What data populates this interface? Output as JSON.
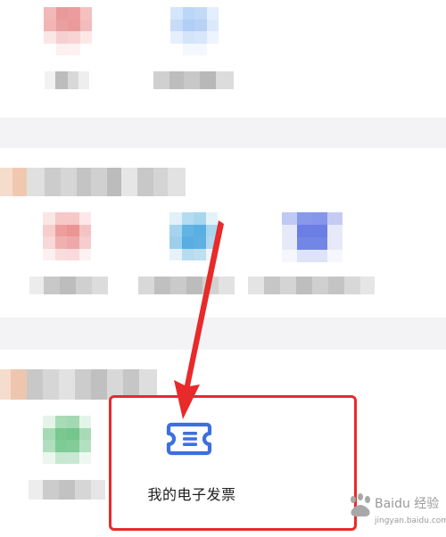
{
  "highlighted_item": {
    "label": "我的电子发票",
    "icon": "ticket-icon",
    "icon_color": "#3d6fe0"
  },
  "annotation": {
    "arrow_color": "#e82a2a",
    "box_color": "#e82a2a"
  },
  "watermark": {
    "text": "Baidu 经验",
    "sub": "jingyan.baidu.com"
  }
}
